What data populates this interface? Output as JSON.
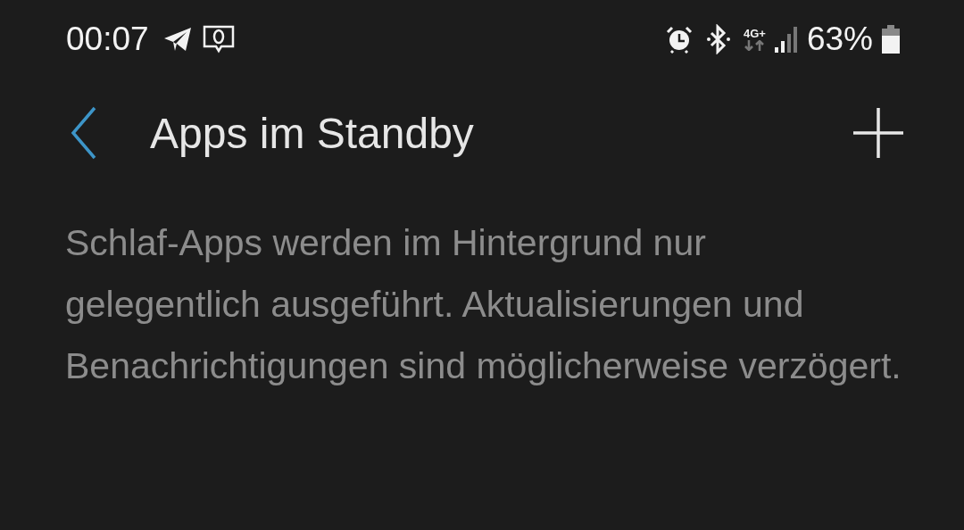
{
  "status_bar": {
    "time": "00:07",
    "network_type": "4G+",
    "battery_percent": "63%"
  },
  "header": {
    "title": "Apps im Standby"
  },
  "description": "Schlaf-Apps werden im Hintergrund nur gelegentlich ausgeführt. Aktualisierungen und Benachrichtigungen sind möglicherweise verzögert."
}
